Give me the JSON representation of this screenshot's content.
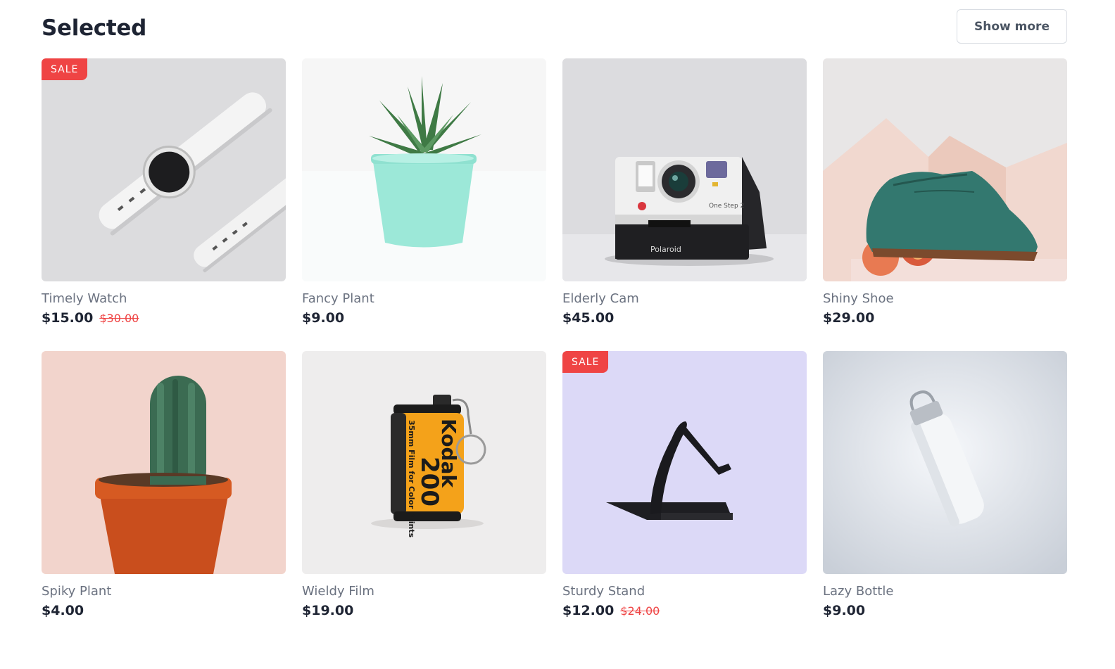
{
  "section": {
    "title": "Selected",
    "show_more_label": "Show more"
  },
  "badge_label": "SALE",
  "colors": {
    "sale": "#ef4444",
    "title": "#1e2433",
    "name": "#6b7280"
  },
  "products": [
    {
      "name": "Timely Watch",
      "price": "$15.00",
      "old_price": "$30.00",
      "sale": true,
      "image": "smartwatch"
    },
    {
      "name": "Fancy Plant",
      "price": "$9.00",
      "old_price": "",
      "sale": false,
      "image": "succulent-plant"
    },
    {
      "name": "Elderly Cam",
      "price": "$45.00",
      "old_price": "",
      "sale": false,
      "image": "instant-camera"
    },
    {
      "name": "Shiny Shoe",
      "price": "$29.00",
      "old_price": "",
      "sale": false,
      "image": "green-shoe"
    },
    {
      "name": "Spiky Plant",
      "price": "$4.00",
      "old_price": "",
      "sale": false,
      "image": "cactus-plant"
    },
    {
      "name": "Wieldy Film",
      "price": "$19.00",
      "old_price": "",
      "sale": false,
      "image": "film-roll"
    },
    {
      "name": "Sturdy Stand",
      "price": "$12.00",
      "old_price": "$24.00",
      "sale": true,
      "image": "phone-stand"
    },
    {
      "name": "Lazy Bottle",
      "price": "$9.00",
      "old_price": "",
      "sale": false,
      "image": "water-bottle"
    }
  ],
  "image_text": {
    "camera_brand": "Polaroid",
    "camera_model": "One Step 2",
    "film_brand": "Kodak",
    "film_speed": "200",
    "film_desc": "35mm Film for Color Prints"
  }
}
